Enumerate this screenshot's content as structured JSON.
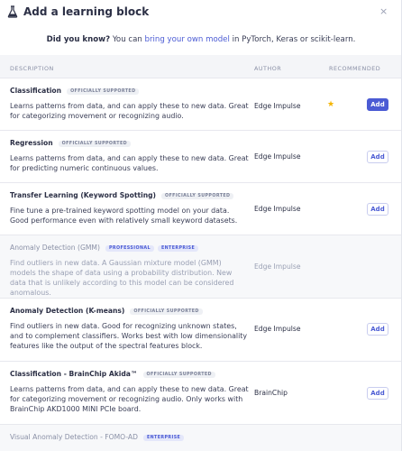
{
  "dialog": {
    "title": "Add a learning block",
    "close_label": "×"
  },
  "banner": {
    "lead": "Did you know?",
    "pre": "You can ",
    "link": "bring your own model",
    "post": " in PyTorch, Keras or scikit-learn."
  },
  "columns": {
    "description": "DESCRIPTION",
    "author": "AUTHOR",
    "recommended": "RECOMMENDED"
  },
  "blocks": [
    {
      "title": "Classification",
      "badge": "OFFICIALLY SUPPORTED",
      "description": "Learns patterns from data, and can apply these to new data. Great for categorizing movement or recognizing audio.",
      "author": "Edge Impulse",
      "button": "Add"
    },
    {
      "title": "Regression",
      "badge": "OFFICIALLY SUPPORTED",
      "description": "Learns patterns from data, and can apply these to new data. Great for predicting numeric continuous values.",
      "author": "Edge Impulse",
      "button": "Add"
    },
    {
      "title": "Transfer Learning (Keyword Spotting)",
      "badge": "OFFICIALLY SUPPORTED",
      "description": "Fine tune a pre-trained keyword spotting model on your data. Good performance even with relatively small keyword datasets.",
      "author": "Edge Impulse",
      "button": "Add"
    },
    {
      "title": "Anomaly Detection (GMM)",
      "badge": "PROFESSIONAL",
      "badge2": "ENTERPRISE",
      "description": "Find outliers in new data. A Gaussian mixture model (GMM) models the shape of data using a probability distribution. New data that is unlikely according to this model can be considered anomalous.",
      "author": "Edge Impulse"
    },
    {
      "title": "Anomaly Detection (K-means)",
      "badge": "OFFICIALLY SUPPORTED",
      "description": "Find outliers in new data. Good for recognizing unknown states, and to complement classifiers. Works best with low dimensionality features like the output of the spectral features block.",
      "author": "Edge Impulse",
      "button": "Add"
    },
    {
      "title": "Classification - BrainChip Akida™",
      "badge": "OFFICIALLY SUPPORTED",
      "description": "Learns patterns from data, and can apply these to new data. Great for categorizing movement or recognizing audio. Only works with BrainChip AKD1000 MINI PCIe board.",
      "author": "BrainChip",
      "button": "Add"
    },
    {
      "title": "Visual Anomaly Detection - FOMO-AD",
      "badge": "ENTERPRISE"
    }
  ],
  "recommended_icon": "star-icon",
  "colors": {
    "accent": "#4b5bd4",
    "star": "#f4b400"
  }
}
